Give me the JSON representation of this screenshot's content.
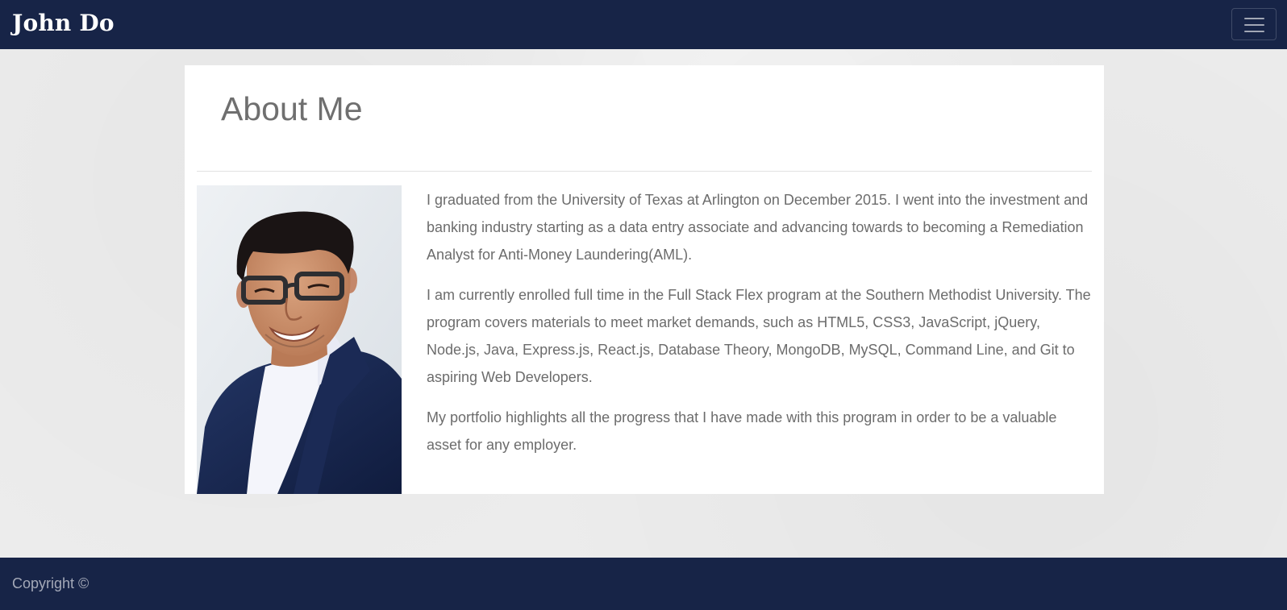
{
  "navbar": {
    "brand": "John Do",
    "toggler_icon": "hamburger-menu-icon"
  },
  "about": {
    "title": "About Me",
    "photo_alt": "portrait photo",
    "paragraphs": [
      "I graduated from the University of Texas at Arlington on December 2015. I went into the investment and banking industry starting as a data entry associate and advancing towards to becoming a Remediation Analyst for Anti-Money Laundering(AML).",
      "I am currently enrolled full time in the Full Stack Flex program at the Southern Methodist University. The program covers materials to meet market demands, such as HTML5, CSS3, JavaScript, jQuery, Node.js, Java, Express.js, React.js, Database Theory, MongoDB, MySQL, Command Line, and Git to aspiring Web Developers.",
      "My portfolio highlights all the progress that I have made with this program in order to be a valuable asset for any employer."
    ]
  },
  "footer": {
    "copyright": "Copyright ©"
  },
  "colors": {
    "navbar_bg": "#172447",
    "page_bg": "#ececec",
    "text": "#6c6c6c"
  }
}
